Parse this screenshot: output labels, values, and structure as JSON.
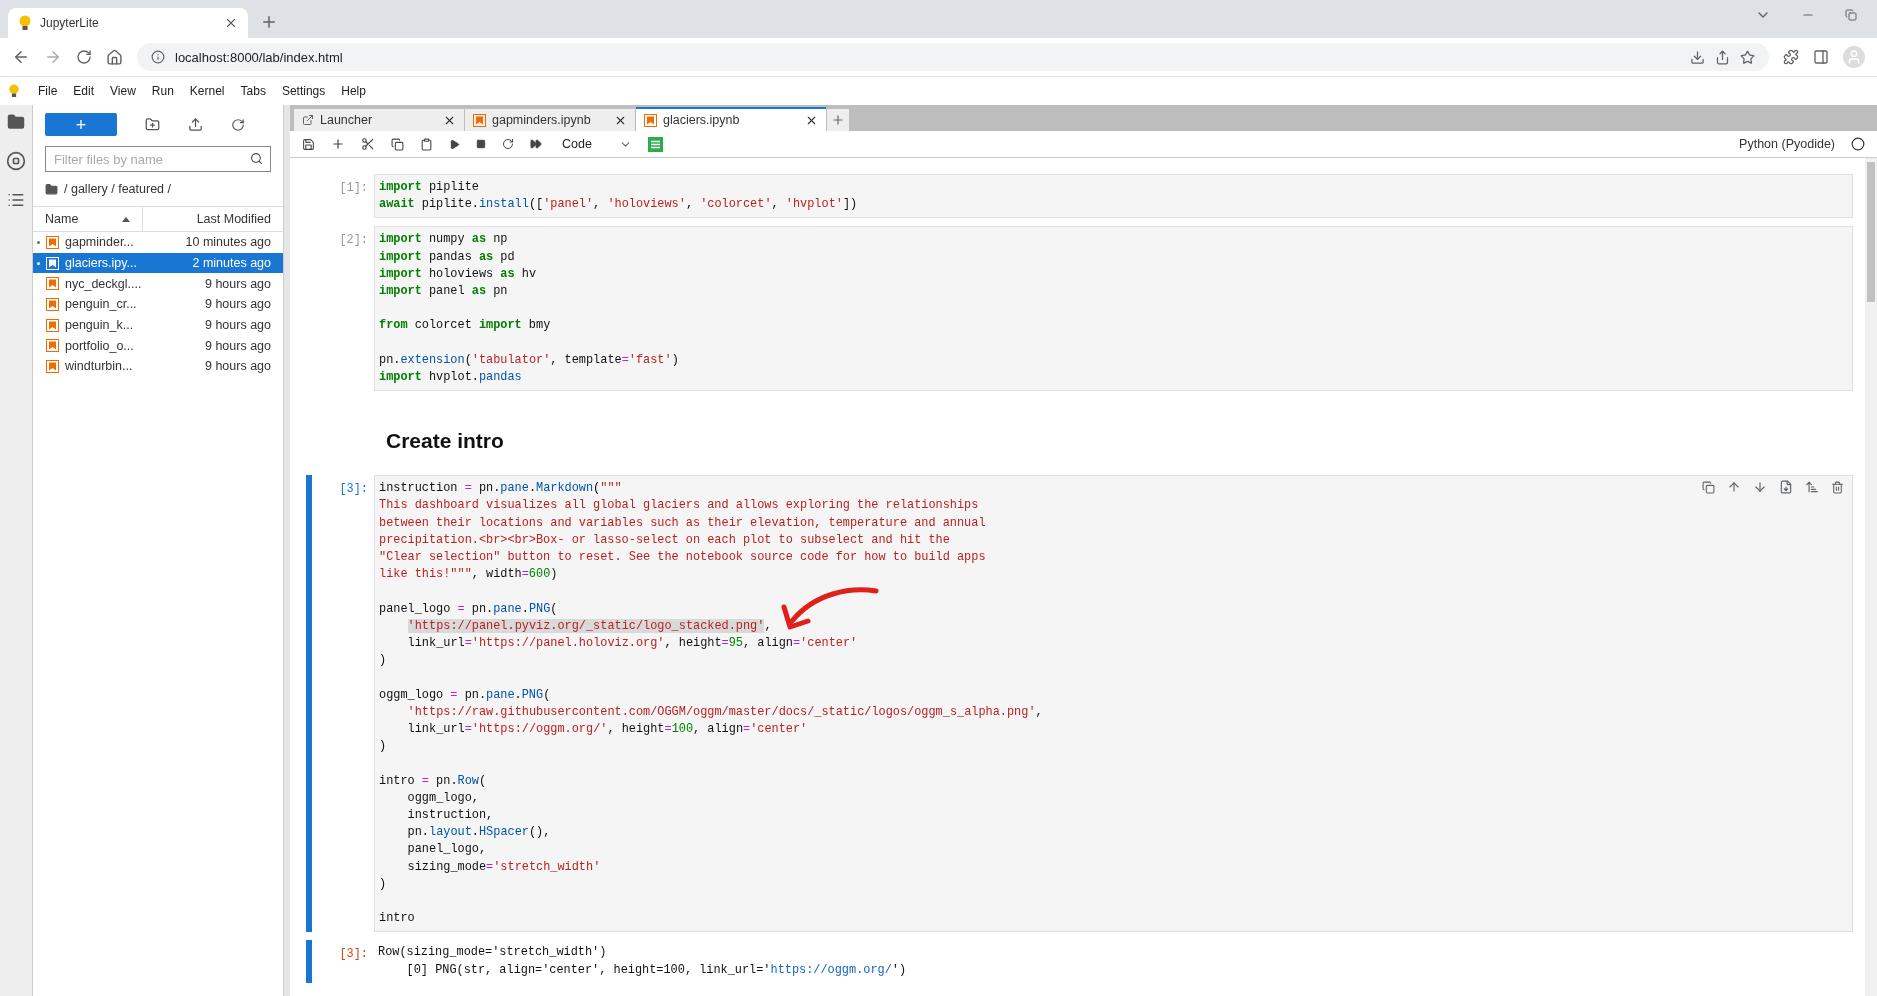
{
  "browser": {
    "tab_title": "JupyterLite",
    "url": "localhost:8000/lab/index.html"
  },
  "menu": [
    "File",
    "Edit",
    "View",
    "Run",
    "Kernel",
    "Tabs",
    "Settings",
    "Help"
  ],
  "sidebar": {
    "new_button": "+",
    "filter_placeholder": "Filter files by name",
    "breadcrumb": "/ gallery / featured /",
    "columns": [
      "Name",
      "Last Modified"
    ],
    "files": [
      {
        "name": "gapminder...",
        "modified": "10 minutes ago",
        "selected": false,
        "running": true
      },
      {
        "name": "glaciers.ipy...",
        "modified": "2 minutes ago",
        "selected": true,
        "running": true
      },
      {
        "name": "nyc_deckgl....",
        "modified": "9 hours ago",
        "selected": false,
        "running": false
      },
      {
        "name": "penguin_cr...",
        "modified": "9 hours ago",
        "selected": false,
        "running": false
      },
      {
        "name": "penguin_k...",
        "modified": "9 hours ago",
        "selected": false,
        "running": false
      },
      {
        "name": "portfolio_o...",
        "modified": "9 hours ago",
        "selected": false,
        "running": false
      },
      {
        "name": "windturbin...",
        "modified": "9 hours ago",
        "selected": false,
        "running": false
      }
    ]
  },
  "notebook": {
    "tabs": [
      {
        "label": "Launcher",
        "kind": "launcher",
        "selected": false
      },
      {
        "label": "gapminders.ipynb",
        "kind": "notebook",
        "selected": false
      },
      {
        "label": "glaciers.ipynb",
        "kind": "notebook",
        "selected": true
      }
    ],
    "cell_type": "Code",
    "kernel": "Python (Pyodide)",
    "cells": [
      {
        "kind": "code",
        "prompt": "[1]:",
        "active": false,
        "blocks": [
          [
            {
              "indent": false,
              "tokens": [
                {
                  "kind": "keyword",
                  "text": "import"
                },
                " piplite"
              ]
            },
            {
              "indent": false,
              "tokens": [
                {
                  "kind": "keyword",
                  "text": "await"
                },
                " piplite.",
                {
                  "kind": "function",
                  "text": "install"
                },
                "([",
                {
                  "kind": "string",
                  "text": "'panel'"
                },
                ", ",
                {
                  "kind": "string",
                  "text": "'holoviews'"
                },
                ", ",
                {
                  "kind": "string",
                  "text": "'colorcet'"
                },
                ", ",
                {
                  "kind": "string",
                  "text": "'hvplot'"
                },
                "])"
              ]
            }
          ]
        ]
      },
      {
        "kind": "code",
        "prompt": "[2]:",
        "active": false,
        "blocks": [
          [
            {
              "indent": false,
              "tokens": [
                {
                  "kind": "keyword",
                  "text": "import"
                },
                " numpy ",
                {
                  "kind": "keyword",
                  "text": "as"
                },
                " np"
              ]
            },
            {
              "indent": false,
              "tokens": [
                {
                  "kind": "keyword",
                  "text": "import"
                },
                " pandas ",
                {
                  "kind": "keyword",
                  "text": "as"
                },
                " pd"
              ]
            },
            {
              "indent": false,
              "tokens": [
                {
                  "kind": "keyword",
                  "text": "import"
                },
                " holoviews ",
                {
                  "kind": "keyword",
                  "text": "as"
                },
                " hv"
              ]
            },
            {
              "indent": false,
              "tokens": [
                {
                  "kind": "keyword",
                  "text": "import"
                },
                " panel ",
                {
                  "kind": "keyword",
                  "text": "as"
                },
                " pn"
              ]
            }
          ],
          [
            {
              "indent": false,
              "tokens": [
                {
                  "kind": "keyword",
                  "text": "from"
                },
                " colorcet ",
                {
                  "kind": "keyword",
                  "text": "import"
                },
                " bmy"
              ]
            }
          ],
          [
            {
              "indent": false,
              "tokens": [
                "pn.",
                {
                  "kind": "function",
                  "text": "extension"
                },
                "(",
                {
                  "kind": "string",
                  "text": "'tabulator'"
                },
                ", template",
                {
                  "kind": "operator",
                  "text": "="
                },
                {
                  "kind": "string",
                  "text": "'fast'"
                },
                ")"
              ]
            },
            {
              "indent": false,
              "tokens": [
                {
                  "kind": "keyword",
                  "text": "import"
                },
                " hvplot.",
                {
                  "kind": "function",
                  "text": "pandas"
                }
              ]
            }
          ]
        ]
      },
      {
        "kind": "markdown",
        "heading": "Create intro"
      },
      {
        "kind": "code",
        "prompt": "[3]:",
        "active": true,
        "blocks": [
          [
            {
              "indent": false,
              "tokens": [
                "instruction ",
                {
                  "kind": "operator",
                  "text": "="
                },
                " pn.",
                {
                  "kind": "function",
                  "text": "pane"
                },
                ".",
                {
                  "kind": "function",
                  "text": "Markdown"
                },
                "(",
                {
                  "kind": "string",
                  "text": "\"\"\""
                }
              ]
            },
            {
              "indent": false,
              "tokens": [
                {
                  "kind": "string",
                  "text": "This dashboard visualizes all global glaciers and allows exploring the relationships"
                }
              ]
            },
            {
              "indent": false,
              "tokens": [
                {
                  "kind": "string",
                  "text": "between their locations and variables such as their elevation, temperature and annual"
                }
              ]
            },
            {
              "indent": false,
              "tokens": [
                {
                  "kind": "string",
                  "text": "precipitation.<br><br>Box- or lasso-select on each plot to subselect and hit the"
                }
              ]
            },
            {
              "indent": false,
              "tokens": [
                {
                  "kind": "string",
                  "text": "\"Clear selection\" button to reset. See the notebook source code for how to build apps"
                }
              ]
            },
            {
              "indent": false,
              "tokens": [
                {
                  "kind": "string",
                  "text": "like this!\"\"\""
                },
                ", width",
                {
                  "kind": "operator",
                  "text": "="
                },
                {
                  "kind": "number",
                  "text": "600"
                },
                ")"
              ]
            }
          ],
          [
            {
              "indent": false,
              "tokens": [
                "panel_logo ",
                {
                  "kind": "operator",
                  "text": "="
                },
                " pn.",
                {
                  "kind": "function",
                  "text": "pane"
                },
                ".",
                {
                  "kind": "function",
                  "text": "PNG"
                },
                "("
              ]
            },
            {
              "indent": true,
              "tokens": [
                {
                  "kind": "highlighted",
                  "text": "'https://panel.pyviz.org/_static/logo_stacked.png'"
                },
                ","
              ]
            },
            {
              "indent": true,
              "tokens": [
                "link_url",
                {
                  "kind": "operator",
                  "text": "="
                },
                {
                  "kind": "string",
                  "text": "'https://panel.holoviz.org'"
                },
                ", height",
                {
                  "kind": "operator",
                  "text": "="
                },
                {
                  "kind": "number",
                  "text": "95"
                },
                ", align",
                {
                  "kind": "operator",
                  "text": "="
                },
                {
                  "kind": "string",
                  "text": "'center'"
                }
              ]
            },
            {
              "indent": false,
              "tokens": [
                ")"
              ]
            }
          ],
          [
            {
              "indent": false,
              "tokens": [
                "oggm_logo ",
                {
                  "kind": "operator",
                  "text": "="
                },
                " pn.",
                {
                  "kind": "function",
                  "text": "pane"
                },
                ".",
                {
                  "kind": "function",
                  "text": "PNG"
                },
                "("
              ]
            },
            {
              "indent": true,
              "tokens": [
                {
                  "kind": "string",
                  "text": "'https://raw.githubusercontent.com/OGGM/oggm/master/docs/_static/logos/oggm_s_alpha.png'"
                },
                ","
              ]
            },
            {
              "indent": true,
              "tokens": [
                "link_url",
                {
                  "kind": "operator",
                  "text": "="
                },
                {
                  "kind": "string",
                  "text": "'https://oggm.org/'"
                },
                ", height",
                {
                  "kind": "operator",
                  "text": "="
                },
                {
                  "kind": "number",
                  "text": "100"
                },
                ", align",
                {
                  "kind": "operator",
                  "text": "="
                },
                {
                  "kind": "string",
                  "text": "'center'"
                }
              ]
            },
            {
              "indent": false,
              "tokens": [
                ")"
              ]
            }
          ],
          [
            {
              "indent": false,
              "tokens": [
                "intro ",
                {
                  "kind": "operator",
                  "text": "="
                },
                " pn.",
                {
                  "kind": "function",
                  "text": "Row"
                },
                "("
              ]
            },
            {
              "indent": true,
              "tokens": [
                "oggm_logo,"
              ]
            },
            {
              "indent": true,
              "tokens": [
                "instruction,"
              ]
            },
            {
              "indent": true,
              "tokens": [
                "pn.",
                {
                  "kind": "function",
                  "text": "layout"
                },
                ".",
                {
                  "kind": "function",
                  "text": "HSpacer"
                },
                "(),"
              ]
            },
            {
              "indent": true,
              "tokens": [
                "panel_logo,"
              ]
            },
            {
              "indent": true,
              "tokens": [
                "sizing_mode",
                {
                  "kind": "operator",
                  "text": "="
                },
                {
                  "kind": "string",
                  "text": "'stretch_width'"
                }
              ]
            },
            {
              "indent": false,
              "tokens": [
                ")"
              ]
            }
          ],
          [
            {
              "indent": false,
              "tokens": [
                "intro"
              ]
            }
          ]
        ],
        "output": {
          "prompt": "[3]:",
          "lines": [
            {
              "indent": false,
              "tokens": [
                "Row(sizing_mode='stretch_width')"
              ]
            },
            {
              "indent": true,
              "tokens": [
                "[0] PNG(str, align='center', height=100, link_url='",
                {
                  "kind": "link",
                  "text": "https://oggm.org/"
                },
                "')"
              ]
            }
          ]
        }
      }
    ]
  }
}
